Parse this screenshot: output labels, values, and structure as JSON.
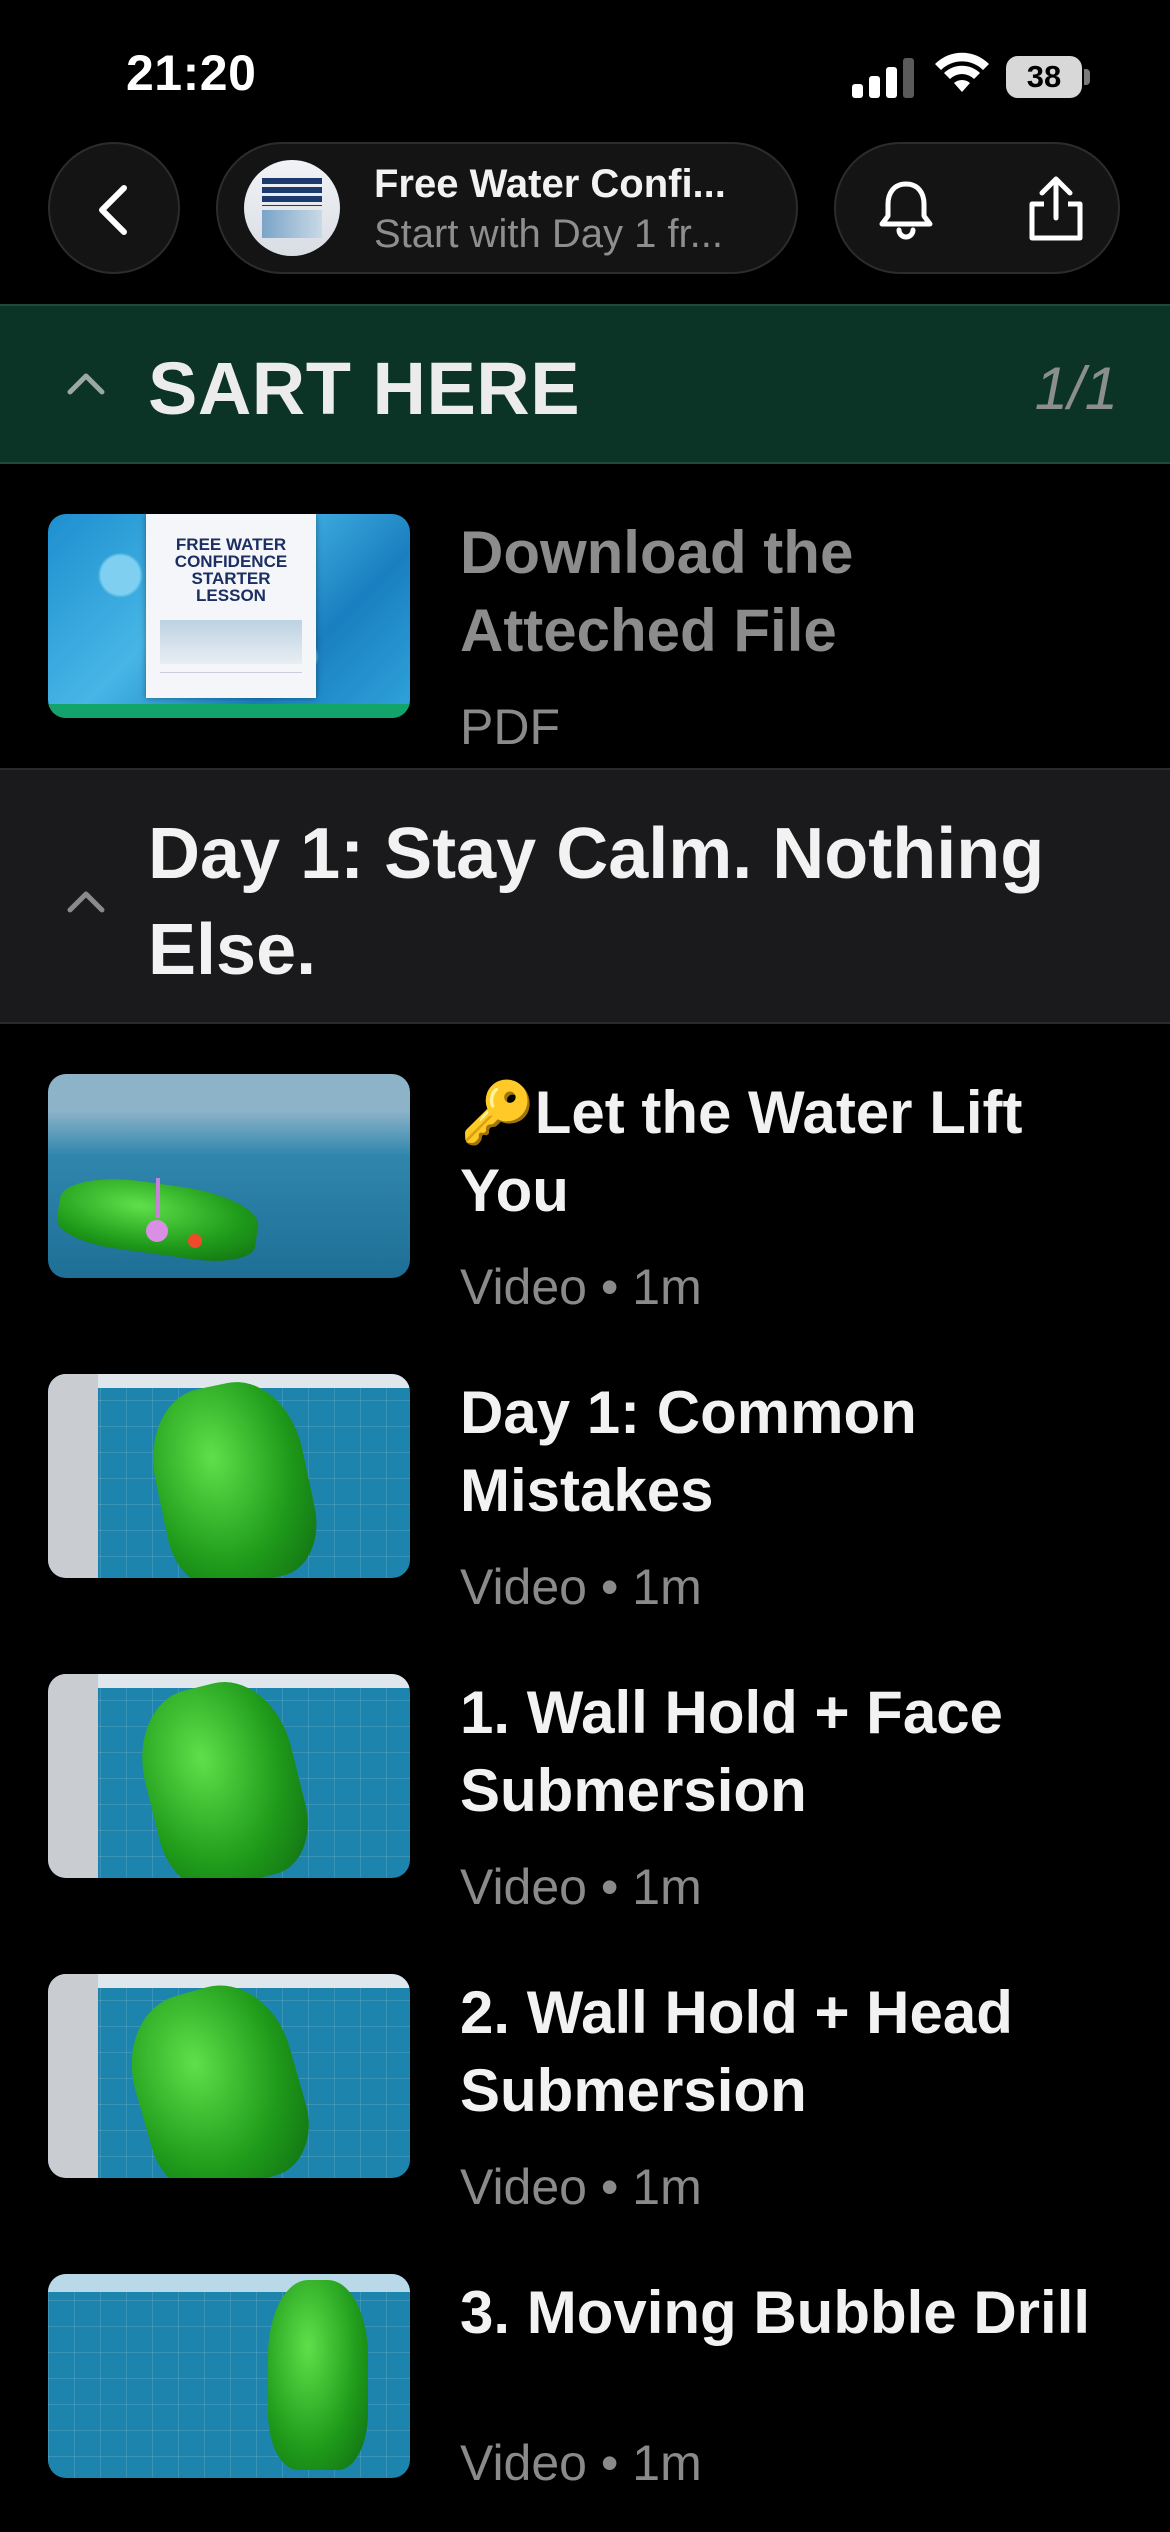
{
  "status_bar": {
    "time": "21:20",
    "battery_level": "38",
    "icons": [
      "signal-icon",
      "wifi-icon",
      "battery-icon"
    ]
  },
  "header": {
    "back_icon": "chevron-left-icon",
    "course_title": "Free Water Confi...",
    "course_subtitle": "Start with Day 1 fr...",
    "bell_icon": "bell-icon",
    "share_icon": "share-icon"
  },
  "sections": [
    {
      "title": "SART HERE",
      "count": "1/1",
      "lessons": [
        {
          "title_line1": "Download the",
          "title_line2": "Atteched File",
          "meta": "PDF",
          "thumb_text": "FREE WATER CONFIDENCE STARTER LESSON"
        }
      ]
    },
    {
      "title_line1": "Day 1: Stay Calm. Nothing",
      "title_line2": "Else.",
      "lessons": [
        {
          "title_line1": "🔑Let the Water Lift",
          "title_line2": "You",
          "meta": "Video • 1m"
        },
        {
          "title_line1": "Day 1: Common",
          "title_line2": "Mistakes",
          "meta": "Video • 1m"
        },
        {
          "title_line1": "1. Wall Hold + Face",
          "title_line2": "Submersion",
          "meta": "Video • 1m"
        },
        {
          "title_line1": "2. Wall Hold + Head",
          "title_line2": "Submersion",
          "meta": "Video • 1m"
        },
        {
          "title_line1": "3. Moving Bubble Drill",
          "title_line2": "",
          "meta": "Video • 1m"
        }
      ]
    }
  ],
  "colors": {
    "background": "#000000",
    "start_section_bg": "#0b3426",
    "day_section_bg": "#1a1a1c",
    "meta_text": "#8a8a8a"
  }
}
